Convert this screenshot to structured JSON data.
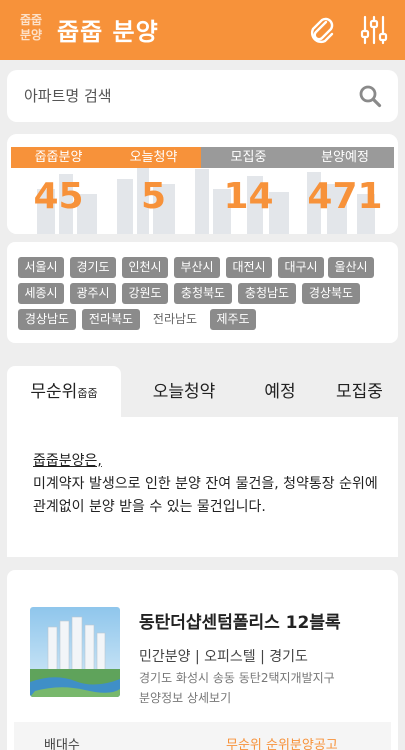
{
  "header": {
    "logo_line1": "줍줍",
    "logo_line2": "분양",
    "title": "줍줍 분양",
    "icons": [
      "paperclip-icon",
      "sliders-icon"
    ]
  },
  "search": {
    "placeholder": "아파트명 검색",
    "icon": "search-icon"
  },
  "stats": [
    {
      "label": "줍줍분양",
      "value": "45",
      "color": "#f7923a"
    },
    {
      "label": "오늘청약",
      "value": "5",
      "color": "#f7923a"
    },
    {
      "label": "모집중",
      "value": "14",
      "color": "#9a9a9a"
    },
    {
      "label": "분양예정",
      "value": "471",
      "color": "#9a9a9a"
    }
  ],
  "regions": [
    "서울시",
    "경기도",
    "인천시",
    "부산시",
    "대전시",
    "대구시",
    "울산시",
    "세종시",
    "광주시",
    "강원도",
    "충청북도",
    "충청남도",
    "경상북도",
    "경상남도",
    "전라북도",
    "전라남도",
    "제주도"
  ],
  "tabs": [
    {
      "label": "무순위",
      "sub": "줍줍"
    },
    {
      "label": "오늘청약"
    },
    {
      "label": "예정"
    },
    {
      "label": "모집중"
    }
  ],
  "description": {
    "title": "줍줍분양은,",
    "body": "미계약자 발생으로 인한 분양 잔여 물건을, 청약통장 순위에 관계없이 분양 받을 수 있는 물건입니다."
  },
  "listing": {
    "title": "동탄더샵센텀폴리스 12블록",
    "meta": "민간분양 | 오피스텔 | 경기도",
    "address": "경기도 화성시 송동 동탄2택지개발지구",
    "link": "분양정보 상세보기",
    "footer_left": "배대수",
    "footer_right": "무순위 순위분양공고"
  },
  "colors": {
    "accent": "#f7923a",
    "chip": "#8b8b8b",
    "background": "#eeeeee"
  }
}
